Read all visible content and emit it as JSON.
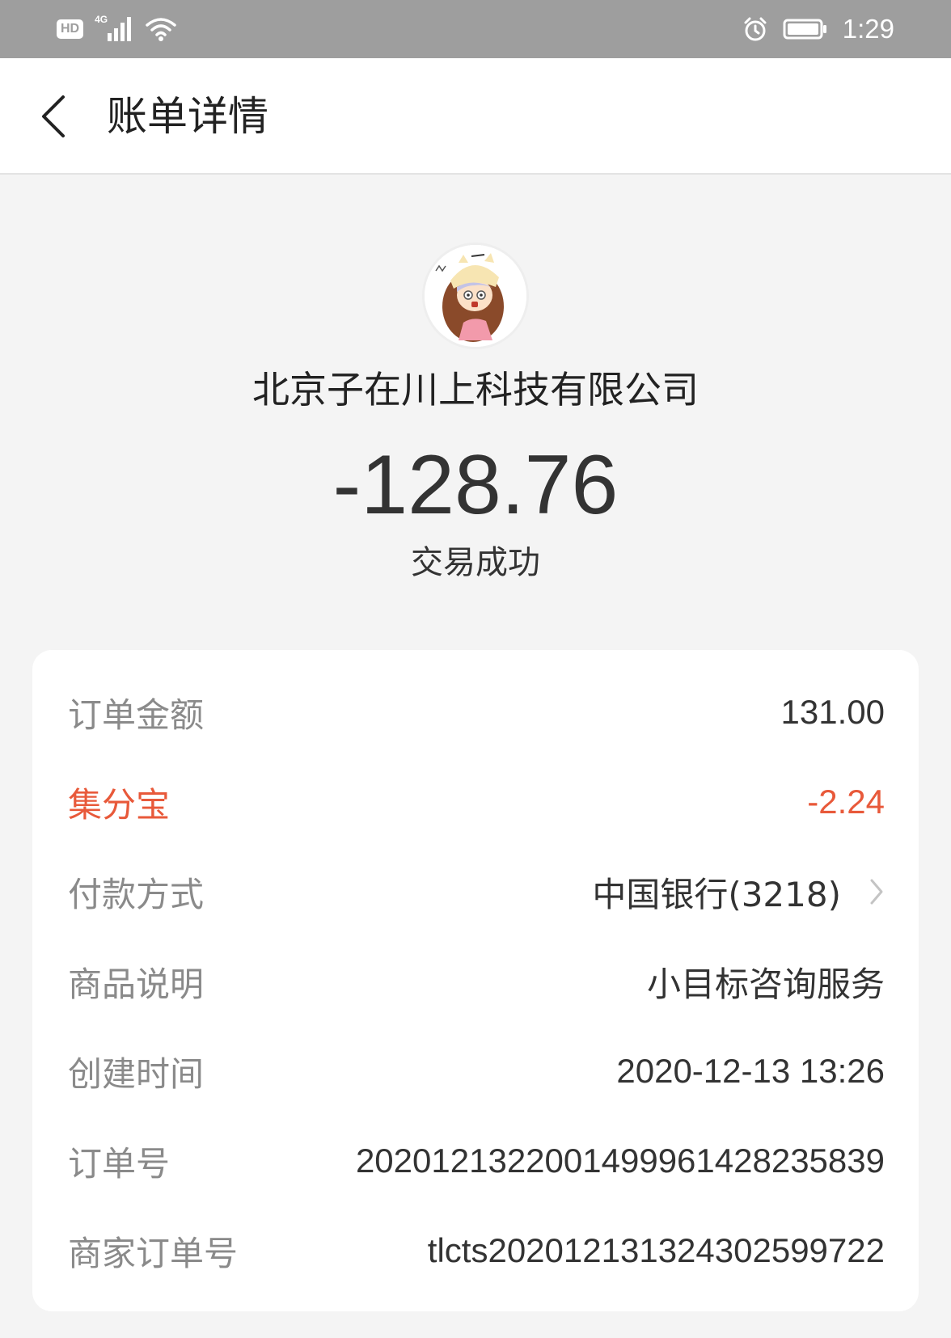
{
  "status_bar": {
    "hd_label": "HD",
    "network_label": "4G",
    "time": "1:29",
    "icons": [
      "hd-icon",
      "signal-icon",
      "wifi-icon",
      "alarm-icon",
      "battery-icon"
    ]
  },
  "header": {
    "title": "账单详情",
    "back_icon": "chevron-left-icon"
  },
  "merchant": {
    "name": "北京子在川上科技有限公司",
    "amount": "-128.76",
    "status": "交易成功"
  },
  "details": {
    "order_amount": {
      "label": "订单金额",
      "value": "131.00"
    },
    "points": {
      "label": "集分宝",
      "value": "-2.24"
    },
    "payment_method": {
      "label": "付款方式",
      "value": "中国银行(3218)"
    },
    "product_desc": {
      "label": "商品说明",
      "value": "小目标咨询服务"
    },
    "created_time": {
      "label": "创建时间",
      "value": "2020-12-13 13:26"
    },
    "order_no": {
      "label": "订单号",
      "value": "2020121322001499961428235839"
    },
    "merchant_order_no": {
      "label": "商家订单号",
      "value": "tlcts20201213132430259972​2"
    }
  },
  "colors": {
    "status_bar_bg": "#9e9e9e",
    "page_bg": "#f4f4f4",
    "highlight": "#e8593a",
    "label_gray": "#8a8a8a"
  }
}
